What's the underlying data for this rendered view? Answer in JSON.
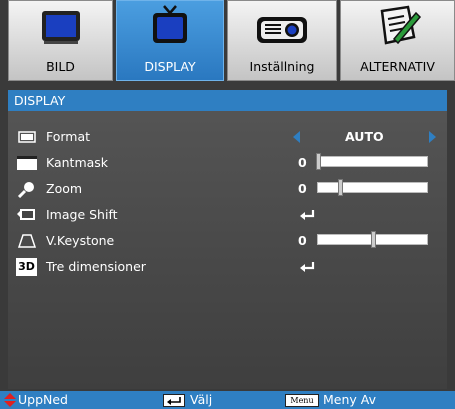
{
  "tabs": [
    {
      "label": "BILD",
      "icon": "monitor-icon",
      "active": false
    },
    {
      "label": "DISPLAY",
      "icon": "tv-icon",
      "active": true
    },
    {
      "label": "Inställning",
      "icon": "projector-icon",
      "active": false
    },
    {
      "label": "ALTERNATIV",
      "icon": "notepad-icon",
      "active": false
    }
  ],
  "panel": {
    "title": "DISPLAY",
    "rows": [
      {
        "label": "Format",
        "icon": "format-icon",
        "type": "select",
        "value": "AUTO"
      },
      {
        "label": "Kantmask",
        "icon": "edge-mask-icon",
        "type": "slider",
        "value": "0",
        "level": 0
      },
      {
        "label": "Zoom",
        "icon": "magnifier-icon",
        "type": "slider",
        "value": "0",
        "level": 0.2
      },
      {
        "label": "Image Shift",
        "icon": "image-shift-icon",
        "type": "enter"
      },
      {
        "label": "V.Keystone",
        "icon": "keystone-icon",
        "type": "slider",
        "value": "0",
        "level": 0.5
      },
      {
        "label": "Tre dimensioner",
        "icon": "3d-icon",
        "type": "enter",
        "icon_text": "3D"
      }
    ]
  },
  "footer": {
    "updown": "UppNed",
    "select": "Välj",
    "menu_key": "Menu",
    "menu_off": "Meny Av"
  },
  "colors": {
    "accent": "#2f7fc2",
    "active_tab": "#3b8fd6",
    "background": "#3a3a3a"
  }
}
